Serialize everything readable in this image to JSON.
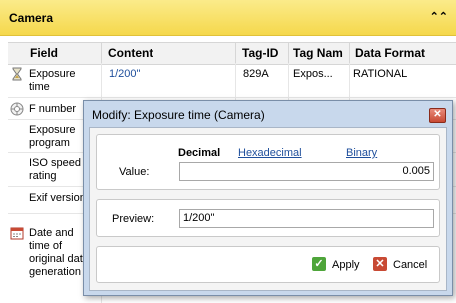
{
  "section": {
    "title": "Camera"
  },
  "columns": [
    "Field",
    "Content",
    "Tag-ID",
    "Tag Nam",
    "Data Format"
  ],
  "rows": [
    {
      "field": [
        "Exposure",
        "time"
      ],
      "content": "1/200\"",
      "tag_id": "829A",
      "tag_name": "Expos...",
      "format": "RATIONAL",
      "icon": "hourglass-icon"
    },
    {
      "field": [
        "F number"
      ],
      "icon": "aperture-icon"
    },
    {
      "field": [
        "Exposure",
        "program"
      ]
    },
    {
      "field": [
        "ISO speed",
        "rating"
      ]
    },
    {
      "field": [
        "Exif version"
      ]
    },
    {
      "field": [
        "Date and",
        "time of",
        "original date",
        "generation"
      ],
      "icon": "calendar-icon"
    }
  ],
  "dialog": {
    "title": "Modify: Exposure time (Camera)",
    "tabs": {
      "decimal": "Decimal",
      "hexadecimal": "Hexadecimal",
      "binary": "Binary"
    },
    "value_label": "Value:",
    "value": "0.005",
    "preview_label": "Preview:",
    "preview_value": "1/200\"",
    "apply_label": "Apply",
    "cancel_label": "Cancel"
  },
  "colors": {
    "header_bg": "#f5d84c",
    "link": "#1f4f9c",
    "dialog_frame": "#c8d8ec",
    "apply": "#4ea53a",
    "cancel": "#c84a34"
  }
}
